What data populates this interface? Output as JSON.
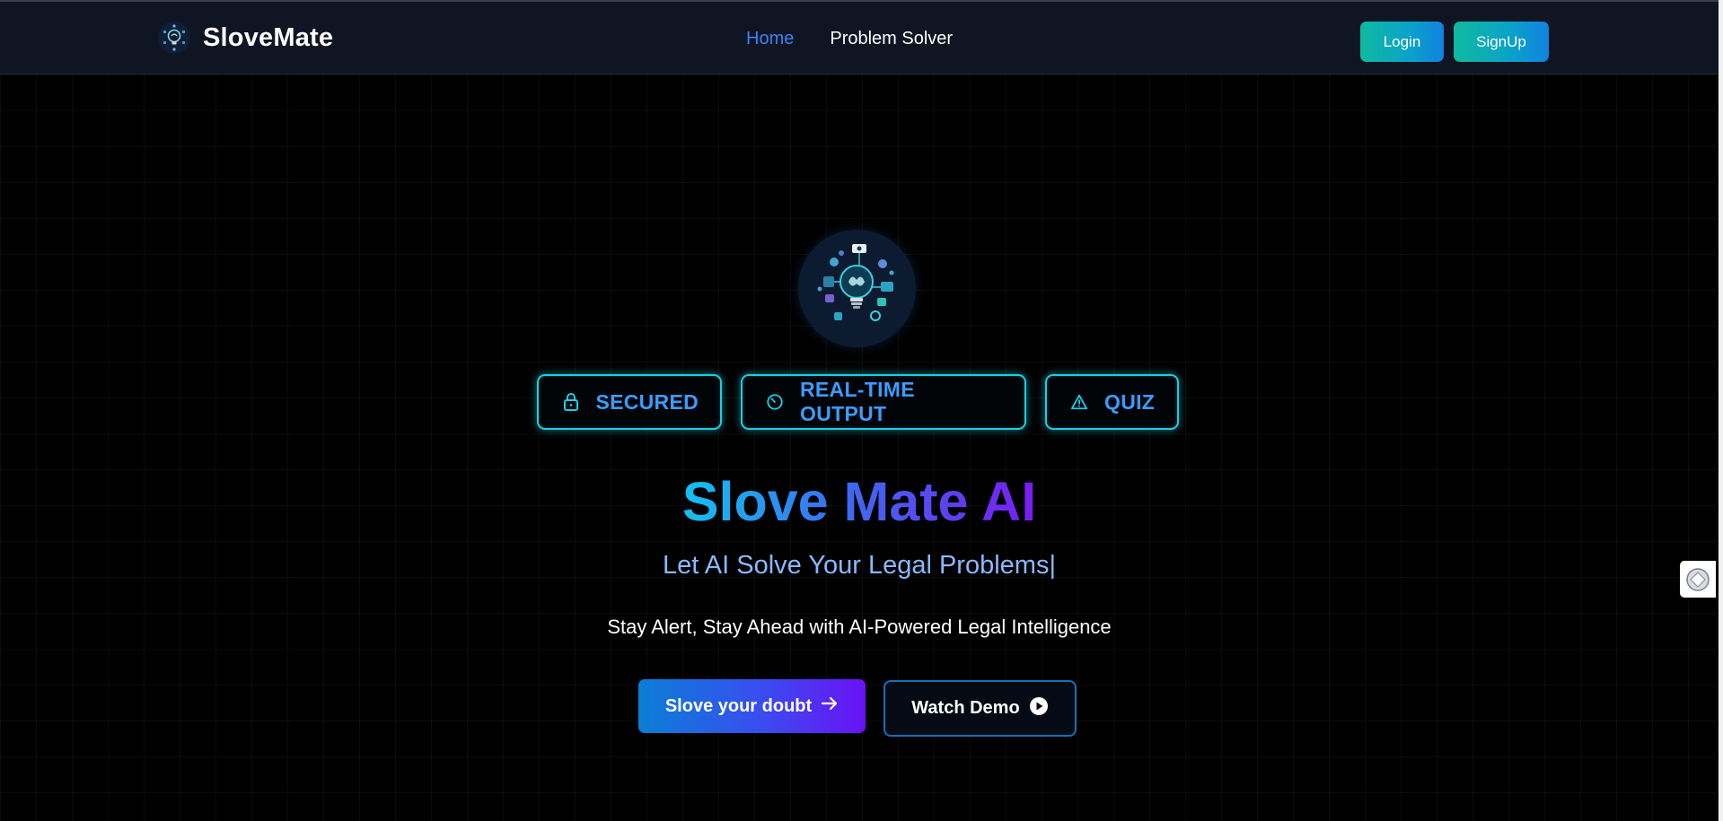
{
  "navbar": {
    "brand_name": "SloveMate",
    "brand_logo_icon": "lightbulb-brain-icon",
    "links": [
      {
        "label": "Home",
        "active": true
      },
      {
        "label": "Problem Solver",
        "active": false
      }
    ],
    "login_label": "Login",
    "signup_label": "SignUp"
  },
  "hero": {
    "logo_icon": "lightbulb-brain-circuit-icon",
    "badges": [
      {
        "label": "SECURED",
        "icon": "lock-icon"
      },
      {
        "label": "REAL-TIME OUTPUT",
        "icon": "timer-icon"
      },
      {
        "label": "QUIZ",
        "icon": "warning-triangle-icon"
      }
    ],
    "title": "Slove Mate AI",
    "subtitle": "Let AI Solve Your Legal Problems|",
    "description": "Stay Alert, Stay Ahead with AI-Powered Legal Intelligence",
    "primary_cta": "Slove your doubt",
    "secondary_cta": "Watch Demo"
  },
  "side_widget_icon": "assistant-widget-icon",
  "colors": {
    "background": "#000000",
    "navbar_bg": "#0f1522",
    "accent_cyan": "#16d1e6",
    "active_link": "#3b82f6",
    "badge_text": "#3b9cff",
    "subtitle": "#8ab8ff"
  }
}
